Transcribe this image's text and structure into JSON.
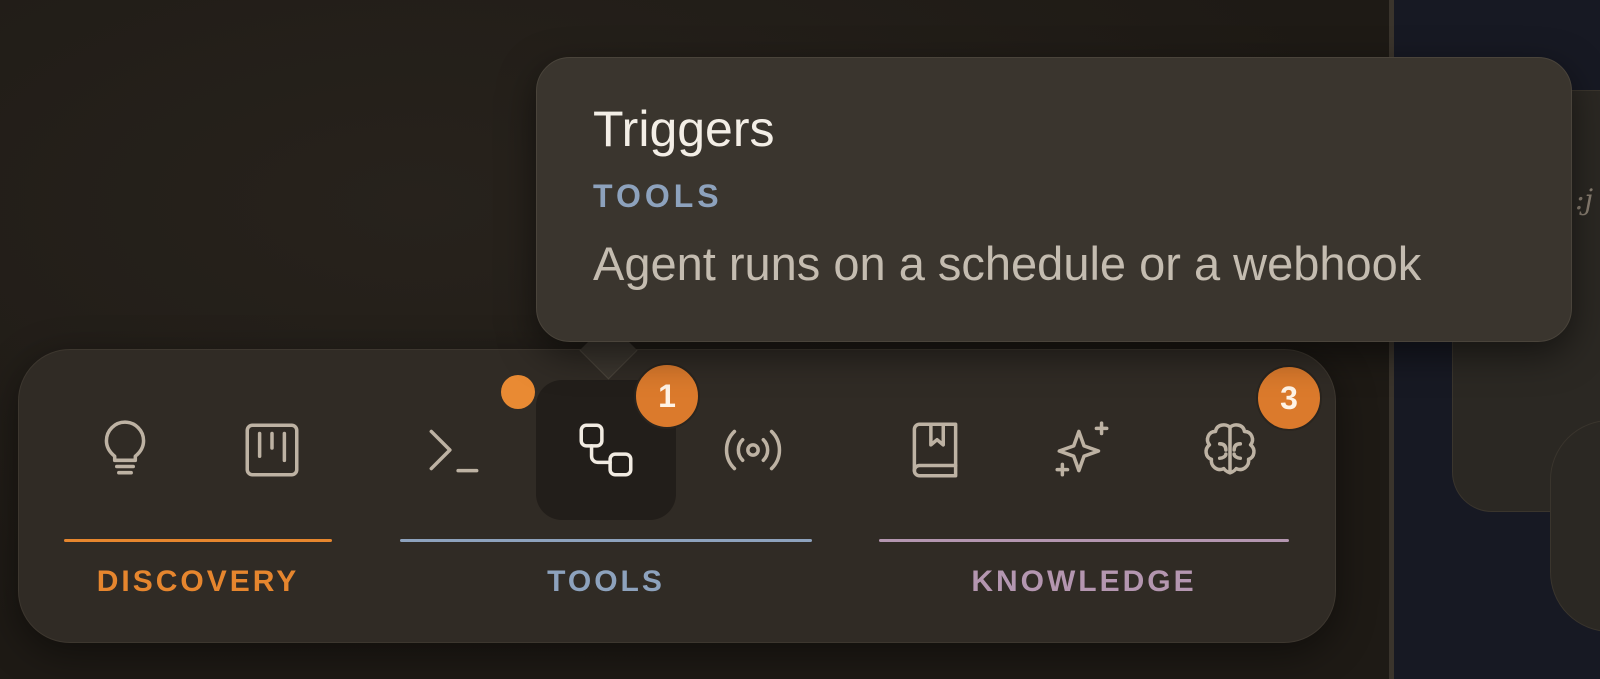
{
  "tooltip": {
    "title": "Triggers",
    "category": "TOOLS",
    "description": "Agent runs on a schedule or a webhook"
  },
  "dock": {
    "groups": [
      {
        "label": "DISCOVERY",
        "color": "#e6862e"
      },
      {
        "label": "TOOLS",
        "color": "#8da2bd"
      },
      {
        "label": "KNOWLEDGE",
        "color": "#b496b0"
      }
    ],
    "items": [
      {
        "icon": "lightbulb-icon",
        "group": "DISCOVERY"
      },
      {
        "icon": "kanban-board-icon",
        "group": "DISCOVERY"
      },
      {
        "icon": "terminal-icon",
        "group": "TOOLS",
        "notification_dot": true
      },
      {
        "icon": "workflow-nodes-icon",
        "group": "TOOLS",
        "active": true,
        "badge": "1"
      },
      {
        "icon": "broadcast-icon",
        "group": "TOOLS"
      },
      {
        "icon": "bookmark-book-icon",
        "group": "KNOWLEDGE"
      },
      {
        "icon": "sparkles-icon",
        "group": "KNOWLEDGE"
      },
      {
        "icon": "brain-icon",
        "group": "KNOWLEDGE",
        "badge": "3"
      }
    ]
  },
  "colors": {
    "badge": "#db7a2c",
    "dock_bg": "#302b25",
    "tooltip_bg": "#3a352e"
  }
}
